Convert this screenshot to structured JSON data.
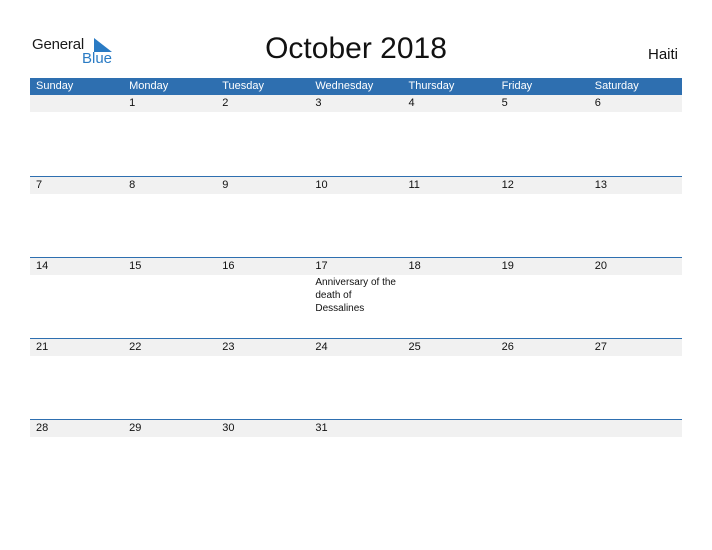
{
  "logo": {
    "word1": "General",
    "word2": "Blue"
  },
  "title": "October 2018",
  "country": "Haiti",
  "colors": {
    "header": "#2e6fb0",
    "brand_blue": "#2a7bc4",
    "date_strip": "#f1f1f1"
  },
  "weekdays": [
    "Sunday",
    "Monday",
    "Tuesday",
    "Wednesday",
    "Thursday",
    "Friday",
    "Saturday"
  ],
  "weeks": [
    {
      "dates": [
        "",
        "1",
        "2",
        "3",
        "4",
        "5",
        "6"
      ],
      "events": [
        "",
        "",
        "",
        "",
        "",
        "",
        ""
      ]
    },
    {
      "dates": [
        "7",
        "8",
        "9",
        "10",
        "11",
        "12",
        "13"
      ],
      "events": [
        "",
        "",
        "",
        "",
        "",
        "",
        ""
      ]
    },
    {
      "dates": [
        "14",
        "15",
        "16",
        "17",
        "18",
        "19",
        "20"
      ],
      "events": [
        "",
        "",
        "",
        "Anniversary of the death of Dessalines",
        "",
        "",
        ""
      ]
    },
    {
      "dates": [
        "21",
        "22",
        "23",
        "24",
        "25",
        "26",
        "27"
      ],
      "events": [
        "",
        "",
        "",
        "",
        "",
        "",
        ""
      ]
    },
    {
      "dates": [
        "28",
        "29",
        "30",
        "31",
        "",
        "",
        ""
      ],
      "events": [
        "",
        "",
        "",
        "",
        "",
        "",
        ""
      ]
    }
  ]
}
